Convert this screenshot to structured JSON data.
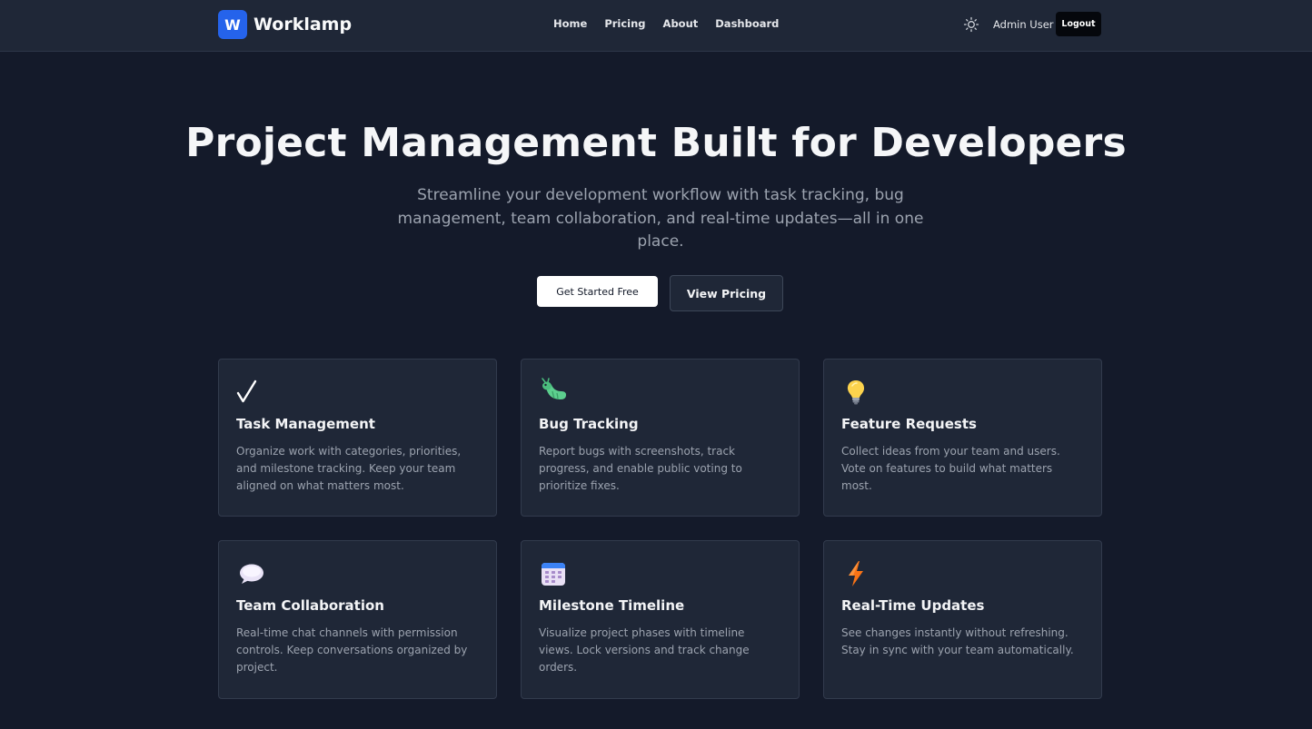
{
  "brand": {
    "logo_letter": "W",
    "name": "Worklamp",
    "color": "#2563eb"
  },
  "nav": {
    "links": [
      "Home",
      "Pricing",
      "About",
      "Dashboard"
    ]
  },
  "header": {
    "theme_icon": "sun-icon",
    "user_name": "Admin User",
    "logout_label": "Logout"
  },
  "hero": {
    "title": "Project Management Built for Developers",
    "subtitle": "Streamline your development workflow with task tracking, bug management, team collaboration, and real-time updates—all in one place.",
    "primary_cta": "Get Started Free",
    "secondary_cta": "View Pricing"
  },
  "features": [
    {
      "icon": "checkmark-icon",
      "title": "Task Management",
      "description": "Organize work with categories, priorities, and milestone tracking. Keep your team aligned on what matters most."
    },
    {
      "icon": "bug-icon",
      "title": "Bug Tracking",
      "description": "Report bugs with screenshots, track progress, and enable public voting to prioritize fixes."
    },
    {
      "icon": "lightbulb-icon",
      "title": "Feature Requests",
      "description": "Collect ideas from your team and users. Vote on features to build what matters most."
    },
    {
      "icon": "speech-bubble-icon",
      "title": "Team Collaboration",
      "description": "Real-time chat channels with permission controls. Keep conversations organized by project."
    },
    {
      "icon": "calendar-icon",
      "title": "Milestone Timeline",
      "description": "Visualize project phases with timeline views. Lock versions and track change orders."
    },
    {
      "icon": "lightning-icon",
      "title": "Real-Time Updates",
      "description": "See changes instantly without refreshing. Stay in sync with your team automatically."
    }
  ],
  "colors": {
    "page_background": "#141a2a",
    "card_background": "#1f2737",
    "muted_text": "#9ca3af"
  }
}
